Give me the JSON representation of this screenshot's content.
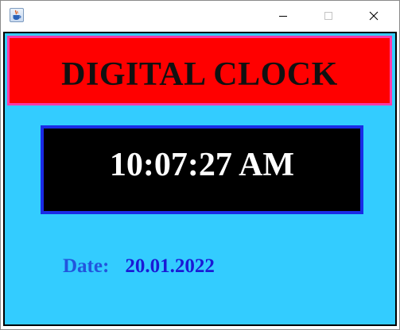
{
  "window": {
    "title": "",
    "app_icon": "java-cup-icon",
    "buttons": {
      "minimize": "minimize-icon",
      "maximize": "maximize-icon",
      "close": "close-icon"
    }
  },
  "header": {
    "title": "DIGITAL CLOCK",
    "background_color": "#ff0000",
    "border_color": "#ff3aa8",
    "text_color": "#111111"
  },
  "clock": {
    "time": "10:07:27 AM",
    "background_color": "#000000",
    "border_color": "#1a2be6",
    "text_color": "#ffffff"
  },
  "date": {
    "label": "Date:",
    "value": "20.01.2022",
    "label_color": "#2255dd",
    "value_color": "#1a1ad6"
  },
  "colors": {
    "panel_background": "#33ccff"
  }
}
